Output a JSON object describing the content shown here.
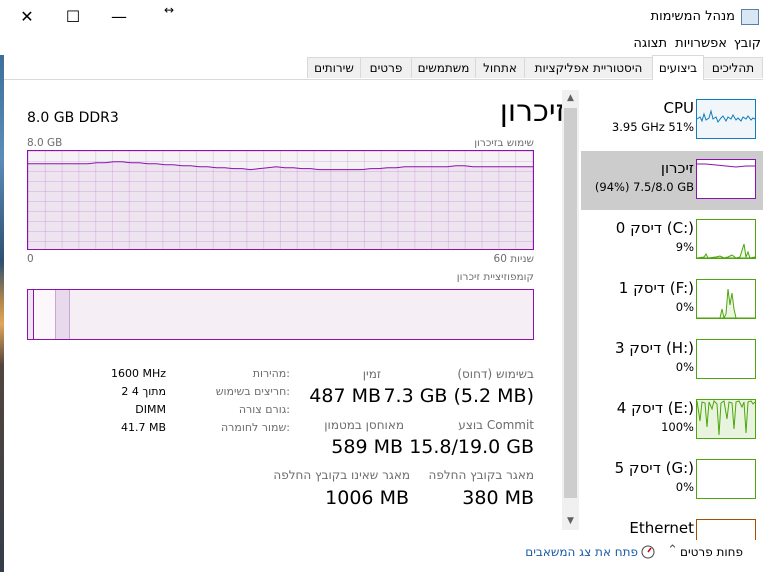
{
  "window": {
    "title": "מנהל המשימות",
    "controls": {
      "close": "✕",
      "maximize": "☐",
      "minimize": "—"
    },
    "resize_glyph": "↔"
  },
  "menu": [
    "קובץ",
    "אפשרויות",
    "תצוגה"
  ],
  "tabs": [
    {
      "label": "תהליכים",
      "active": false
    },
    {
      "label": "ביצועים",
      "active": true
    },
    {
      "label": "היסטוריית אפליקציות",
      "active": false
    },
    {
      "label": "אתחול",
      "active": false
    },
    {
      "label": "משתמשים",
      "active": false
    },
    {
      "label": "פרטים",
      "active": false
    },
    {
      "label": "שירותים",
      "active": false
    }
  ],
  "detail": {
    "title": "זיכרון",
    "subtitle": "8.0 GB DDR3",
    "usage_label": "שימוש בזיכרון",
    "usage_max": "8.0 GB",
    "time_axis_left": "0",
    "time_axis_right": "60 שניות",
    "composition_label": "קומפוזיציית זיכרון",
    "usage_series": [
      0.87,
      0.87,
      0.87,
      0.87,
      0.87,
      0.87,
      0.87,
      0.87,
      0.88,
      0.88,
      0.89,
      0.89,
      0.88,
      0.88,
      0.87,
      0.87,
      0.86,
      0.86,
      0.85,
      0.85,
      0.84,
      0.84,
      0.83,
      0.83,
      0.82,
      0.82,
      0.81,
      0.82,
      0.83,
      0.84,
      0.83,
      0.83,
      0.82,
      0.82,
      0.81,
      0.81,
      0.81,
      0.81,
      0.81,
      0.81,
      0.82,
      0.82,
      0.83,
      0.83,
      0.84,
      0.84,
      0.84,
      0.84,
      0.84,
      0.84,
      0.85,
      0.85,
      0.84,
      0.84,
      0.84,
      0.84,
      0.84,
      0.84,
      0.84,
      0.84
    ],
    "stats": {
      "in_use_label": "בשימוש (דחוס)",
      "in_use_value": "7.3 GB (5.2 MB)",
      "available_label": "זמין",
      "available_value": "487 MB",
      "committed_label": "בוצע Commit",
      "committed_value": "15.8/19.0 GB",
      "cached_label": "מאוחסן במטמון",
      "cached_value": "589 MB",
      "paged_pool_label": "מאגר בקובץ החלפה",
      "paged_pool_value": "380 MB",
      "nonpaged_pool_label": "מאגר שאינו בקובץ החלפה",
      "nonpaged_pool_value": "1006 MB"
    },
    "specs": [
      {
        "label": "מהירות:",
        "value": "1600 MHz"
      },
      {
        "label": "חריצים בשימוש:",
        "value": "2 מתוך 4"
      },
      {
        "label": "גורם צורה:",
        "value": "DIMM"
      },
      {
        "label": "שמור לחומרה:",
        "value": "41.7 MB"
      }
    ]
  },
  "sidebar": [
    {
      "name": "CPU",
      "sub": "3.95 GHz  51%",
      "color": "#117dbb",
      "selected": false
    },
    {
      "name": "זיכרון",
      "sub": "(94%) 7.5/8.0 GB",
      "color": "#8b12ae",
      "selected": true
    },
    {
      "name": "דיסק 0 (C:)",
      "sub": "9%",
      "color": "#4da60c",
      "selected": false
    },
    {
      "name": "דיסק 1 (F:)",
      "sub": "0%",
      "color": "#4da60c",
      "selected": false
    },
    {
      "name": "דיסק 3 (H:)",
      "sub": "0%",
      "color": "#4da60c",
      "selected": false
    },
    {
      "name": "דיסק 4 (E:)",
      "sub": "100%",
      "color": "#4da60c",
      "selected": false
    },
    {
      "name": "דיסק 5 (G:)",
      "sub": "0%",
      "color": "#4da60c",
      "selected": false
    },
    {
      "name": "Ethernet",
      "sub": "",
      "color": "#a74f01",
      "selected": false
    }
  ],
  "footer": {
    "fewer_details": "פחות פרטים",
    "open_resource_monitor": "פתח את צג המשאבים"
  }
}
